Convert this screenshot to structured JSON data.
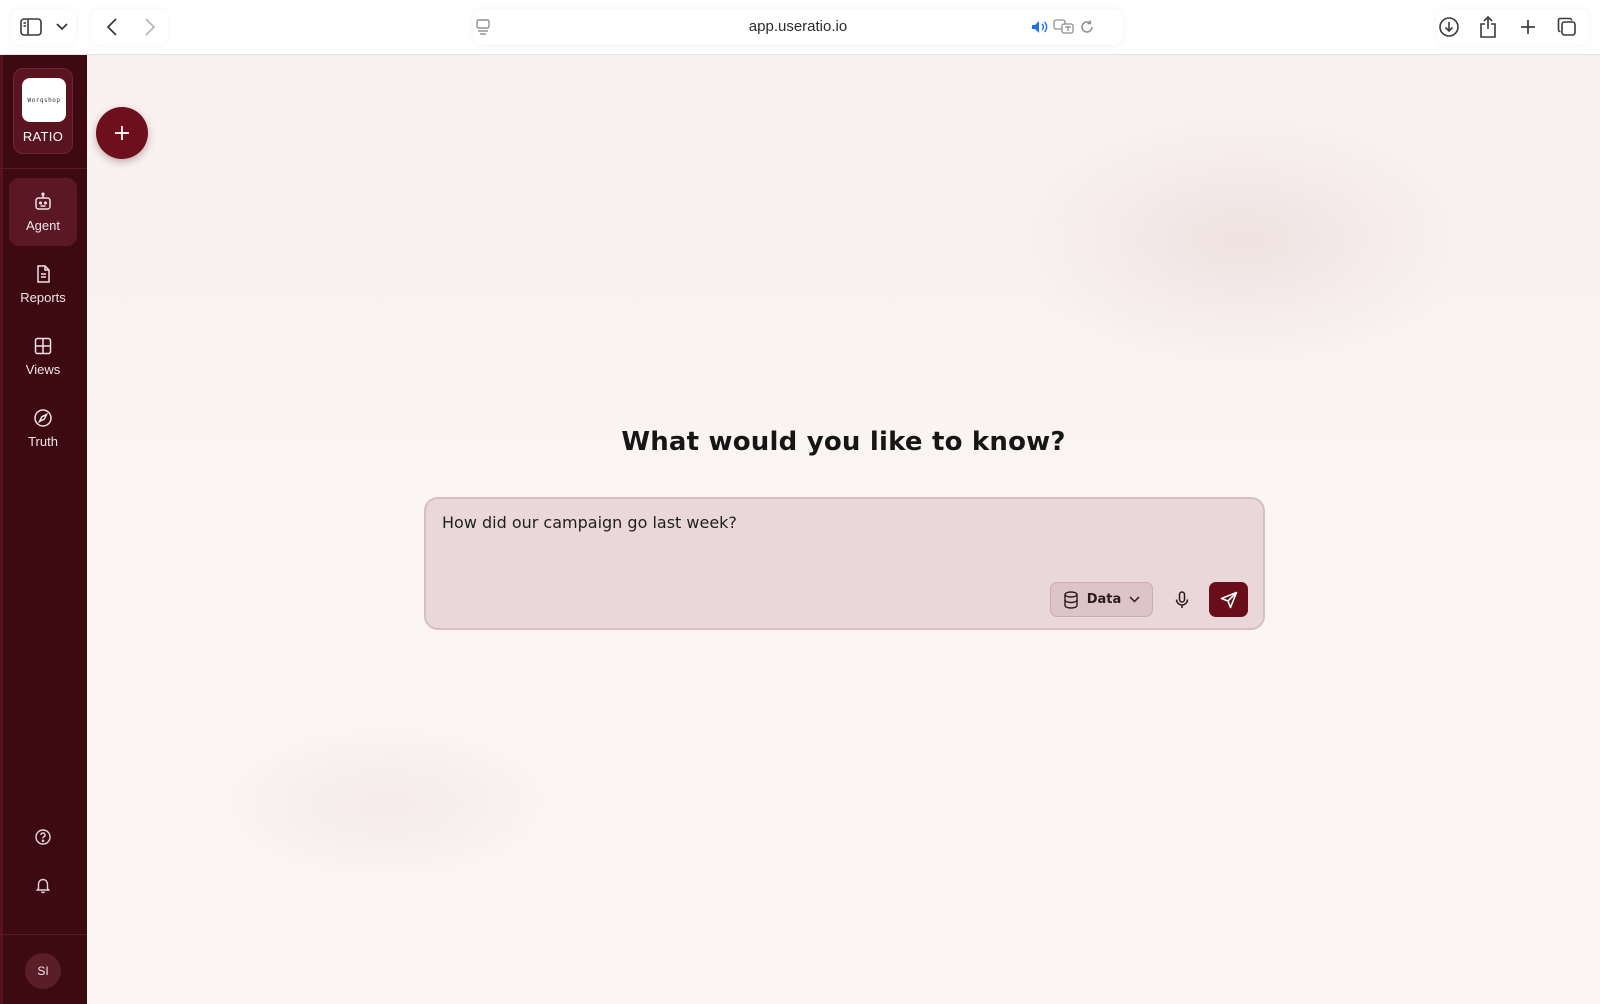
{
  "browser": {
    "url": "app.useratio.io"
  },
  "sidebar": {
    "brand_logo_text": "Worqshop",
    "brand_name": "RATIO",
    "nav": [
      {
        "label": "Agent",
        "icon": "robot-icon",
        "active": true
      },
      {
        "label": "Reports",
        "icon": "document-icon",
        "active": false
      },
      {
        "label": "Views",
        "icon": "grid-icon",
        "active": false
      },
      {
        "label": "Truth",
        "icon": "compass-icon",
        "active": false
      }
    ],
    "avatar_initials": "SI"
  },
  "main": {
    "new_button_symbol": "+",
    "headline": "What would you like to know?",
    "prompt_value": "How did our campaign go last week?",
    "data_button_label": "Data"
  },
  "colors": {
    "sidebar_bg": "#3d0a12",
    "accent": "#6e0f1d",
    "prompt_bg": "#ead7da"
  }
}
